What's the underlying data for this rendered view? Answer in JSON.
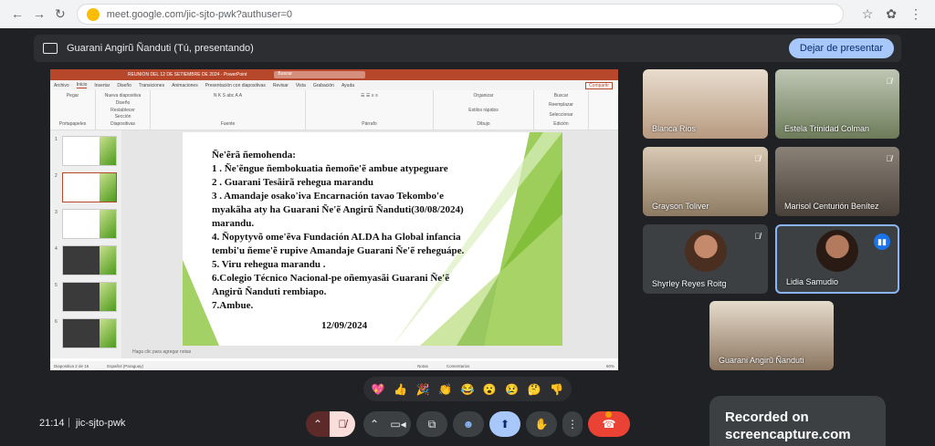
{
  "browser": {
    "url": "meet.google.com/jic-sjto-pwk?authuser=0"
  },
  "presentation_bar": {
    "title": "Guarani Angirũ Ñanduti (Tú, presentando)",
    "stop_label": "Dejar de presentar"
  },
  "ppt": {
    "file_title": "REUNION DEL 12 DE SETIEMBRE DE 2024 - PowerPoint",
    "search_placeholder": "Buscar",
    "menus": [
      "Archivo",
      "Inicio",
      "Insertar",
      "Diseño",
      "Transiciones",
      "Animaciones",
      "Presentación con diapositivas",
      "Revisar",
      "Vista",
      "Grabación",
      "Ayuda"
    ],
    "share_label": "Compartir",
    "ribbon_groups": [
      "Portapapeles",
      "Diapositivas",
      "Fuente",
      "Párrafo",
      "Dibujo",
      "Edición"
    ],
    "ribbon_buttons": {
      "paste": "Pegar",
      "new_slide": "Nueva diapositiva",
      "layout": "Diseño",
      "reset": "Restablecer",
      "section": "Sección",
      "arrange": "Organizar",
      "quick_styles": "Estilos rápidos",
      "find": "Buscar",
      "replace": "Reemplazar",
      "select": "Seleccionar"
    },
    "slide_lines": [
      "Ñe'ẽrã ñemohenda:",
      "1 . Ñe'ẽngue ñembokuatia     ñemoñe'ẽ ambue atypeguare",
      "2 . Guarani Tesãirã rehegua marandu",
      "3 . Amandaje osako'iva Encarnación tavao Tekombo'e",
      "myakãha aty ha Guarani Ñe'ẽ Angirũ Ñanduti(30/08/2024)",
      "marandu.",
      "4. Ñopytyvõ ome'ẽva Fundación ALDA ha Global infancia",
      "tembi'u ñeme'ẽ rupive Amandaje Guarani Ñe'ẽ reheguápe.",
      "5. Viru rehegua marandu .",
      "6.Colegio Técnico Nacional-pe oñemyasãi Guarani Ñe'ẽ",
      "Angirũ Ñanduti rembiapo.",
      "7.Ambue."
    ],
    "slide_date": "12/09/2024",
    "notes_placeholder": "Haga clic para agregar notas",
    "status": {
      "slide_count": "Diapositiva 2 de 16",
      "language": "Español (Paraguay)",
      "notes": "Notas",
      "comments": "Comentarios",
      "zoom": "60%"
    },
    "thumbnail_numbers": [
      "1",
      "2",
      "3",
      "4",
      "5",
      "6"
    ]
  },
  "participants": [
    {
      "name": "Blanca Rios",
      "muted": false
    },
    {
      "name": "Estela Trinidad Colman",
      "muted": true
    },
    {
      "name": "Grayson Toliver",
      "muted": true
    },
    {
      "name": "Marisol Centurión Benítez",
      "muted": true
    },
    {
      "name": "Shyrley Reyes Roitg",
      "muted": true
    },
    {
      "name": "Lidia Samudio",
      "muted": false,
      "speaking": true
    },
    {
      "name": "Guarani Angirũ Ñanduti",
      "muted": false
    }
  ],
  "reactions": [
    "💖",
    "👍",
    "🎉",
    "👏",
    "😂",
    "😮",
    "😢",
    "🤔",
    "👎"
  ],
  "meeting": {
    "time": "21:14",
    "separator": "|",
    "code": "jic-sjto-pwk"
  },
  "watermark": {
    "line1": "Recorded on",
    "line2": "screencapture.com"
  },
  "colors": {
    "meet_bg": "#202124",
    "ppt_accent": "#b7472a",
    "end_call": "#ea4335",
    "present_active": "#a8c7fa",
    "speaking_border": "#8ab4f8"
  }
}
